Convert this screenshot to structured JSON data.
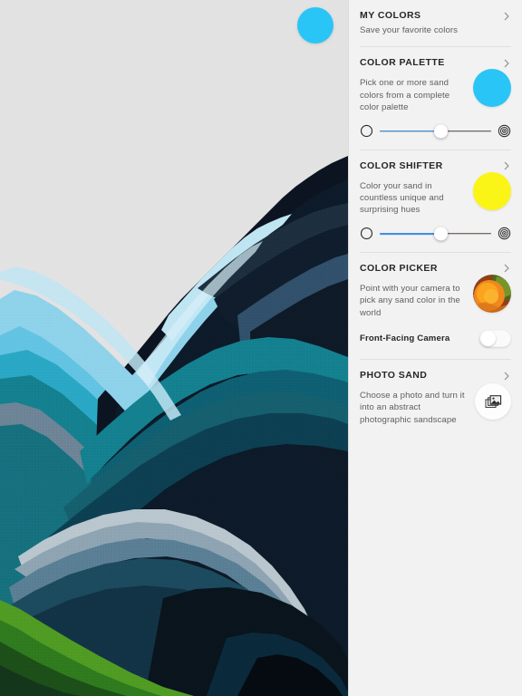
{
  "app": {
    "canvas_bg": "#e2e2e2",
    "panel_bg": "#f2f2f2"
  },
  "canvas": {
    "name": "sand-artwork",
    "floating_swatch": {
      "name": "active-color-swatch",
      "color": "#29c5f6"
    },
    "artwork_palette": {
      "sky": "#e2e2e2",
      "pale_blue": "#8ed2ea",
      "light_blue": "#63c3e2",
      "cyan": "#1d97b5",
      "teal": "#14808f",
      "deep_teal": "#0f5f73",
      "slate": "#31506b",
      "navy": "#14283f",
      "ink": "#0b1420",
      "near_black": "#080d14",
      "silver": "#b9c6ce",
      "steel": "#6d8496",
      "green_light": "#4f9b23",
      "green": "#2f7a1e",
      "green_dark": "#1d4f19",
      "olive": "#14361a"
    }
  },
  "panel": {
    "sections": [
      {
        "id": "my-colors",
        "title": "MY COLORS",
        "subtitle": "Save your favorite colors",
        "chevron": "chevron-right-icon"
      },
      {
        "id": "color-palette",
        "title": "COLOR PALETTE",
        "description": "Pick one or more sand colors from a complete color palette",
        "chevron": "chevron-right-icon",
        "swatch": {
          "name": "color-palette-swatch",
          "color": "#29c5f6"
        },
        "slider": {
          "name": "color-palette-slider",
          "value": 55,
          "min": 0,
          "max": 100,
          "fill_color": "#3d8ef0",
          "track_color": "#4a4038",
          "left_icon": "circle-outline-icon",
          "right_icon": "bullseye-icon"
        }
      },
      {
        "id": "color-shifter",
        "title": "COLOR SHIFTER",
        "description": "Color your sand in countless unique and surprising hues",
        "chevron": "chevron-right-icon",
        "swatch": {
          "name": "color-shifter-swatch",
          "color": "#faf517"
        },
        "slider": {
          "name": "color-shifter-slider",
          "value": 55,
          "min": 0,
          "max": 100,
          "fill_color": "#3d8ef0",
          "track_color": "#4a4038",
          "left_icon": "circle-outline-icon",
          "right_icon": "bullseye-icon"
        }
      },
      {
        "id": "color-picker",
        "title": "COLOR PICKER",
        "description": "Point with your camera to pick any sand color in the world",
        "chevron": "chevron-right-icon",
        "preview": {
          "name": "camera-preview-thumbnail",
          "colors": [
            "#f08a1e",
            "#fba41f",
            "#f9b733",
            "#6e8c22",
            "#3f5e1d",
            "#8f4018"
          ]
        },
        "toggle": {
          "name": "front-facing-camera-toggle",
          "label": "Front-Facing Camera",
          "state": "off"
        }
      },
      {
        "id": "photo-sand",
        "title": "PHOTO SAND",
        "description": "Choose a photo and turn it into an abstract photographic sandscape",
        "chevron": "chevron-right-icon",
        "action_icon": {
          "name": "photo-stack-icon",
          "label": "photo-stack-icon"
        }
      }
    ]
  }
}
